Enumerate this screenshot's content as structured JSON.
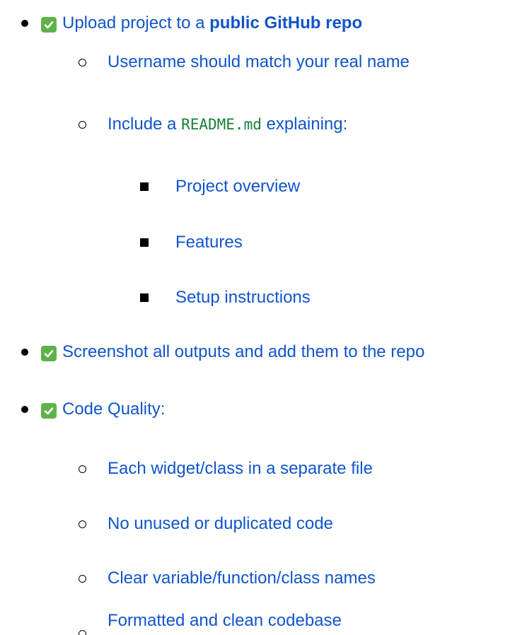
{
  "colors": {
    "link_text": "#1155cc",
    "check_bg": "#5fb24a",
    "code_text": "#188038",
    "bullet": "#000000"
  },
  "items": [
    {
      "icon": "check-box-icon",
      "prefix": "Upload project to a ",
      "bold": "public GitHub repo",
      "children": [
        {
          "text": "Username should match your real name"
        },
        {
          "prefix": "Include a ",
          "code": "README.md",
          "suffix": " explaining:",
          "children": [
            {
              "text": "Project overview"
            },
            {
              "text": "Features"
            },
            {
              "text": "Setup instructions"
            }
          ]
        }
      ]
    },
    {
      "icon": "check-box-icon",
      "text": "Screenshot all outputs and add them to the repo"
    },
    {
      "icon": "check-box-icon",
      "text": "Code Quality:",
      "children": [
        {
          "text": "Each widget/class in a separate file"
        },
        {
          "text": "No unused or duplicated code"
        },
        {
          "text": "Clear variable/function/class names"
        },
        {
          "text": "Formatted and clean codebase"
        }
      ]
    }
  ]
}
